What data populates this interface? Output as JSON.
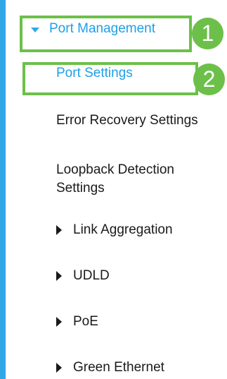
{
  "nav": {
    "items": [
      {
        "label": "Port Management",
        "expanded": true,
        "has_caret": true,
        "highlighted": true
      },
      {
        "label": "Port Settings",
        "selected": true,
        "highlighted": true
      },
      {
        "label": "Error Recovery Settings"
      },
      {
        "label": "Loopback Detection Settings"
      },
      {
        "label": "Link Aggregation",
        "has_caret": true
      },
      {
        "label": "UDLD",
        "has_caret": true
      },
      {
        "label": "PoE",
        "has_caret": true
      },
      {
        "label": "Green Ethernet",
        "has_caret": true
      }
    ]
  },
  "annotations": [
    {
      "number": "1"
    },
    {
      "number": "2"
    }
  ],
  "colors": {
    "accent_blue": "#1f9fe6",
    "left_bar": "#32a7e8",
    "highlight_green": "#6cc04a",
    "text_dark": "#1a1a1a"
  }
}
